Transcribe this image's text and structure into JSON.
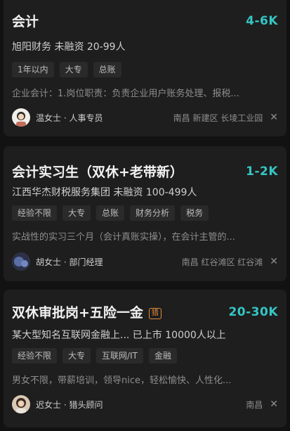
{
  "jobs": [
    {
      "title": "会计",
      "salary": "4-6K",
      "company": "旭阳财务 未融资 20-99人",
      "tags": [
        "1年以内",
        "大专",
        "总账"
      ],
      "description": "企业会计：1.岗位职责：负责企业用户账务处理、报税...",
      "recruiter": "温女士 · 人事专员",
      "location": "南昌 新建区 长堎工业园"
    },
    {
      "title": "会计实习生（双休+老带新）",
      "salary": "1-2K",
      "company": "江西华杰财税服务集团 未融资 100-499人",
      "tags": [
        "经验不限",
        "大专",
        "总账",
        "财务分析",
        "税务"
      ],
      "description": "实战性的实习三个月（会计真账实操），在会计主管的...",
      "recruiter": "胡女士 · 部门经理",
      "location": "南昌 红谷滩区 红谷滩"
    },
    {
      "title": "双休审批岗+五险一金",
      "badge": "猎",
      "salary": "20-30K",
      "company": "某大型知名互联网金融上... 已上市 10000人以上",
      "tags": [
        "经验不限",
        "大专",
        "互联网/IT",
        "金融"
      ],
      "description": "男女不限，带薪培训，领导nice，轻松愉快、人性化...",
      "recruiter": "迟女士 · 猎头顾问",
      "location": "南昌"
    }
  ],
  "colors": {
    "accent": "#35c6c4",
    "badge": "#e08a3c",
    "card": "#1e1e1e",
    "background": "#121212"
  },
  "icons": {
    "dismiss": "close-icon"
  }
}
